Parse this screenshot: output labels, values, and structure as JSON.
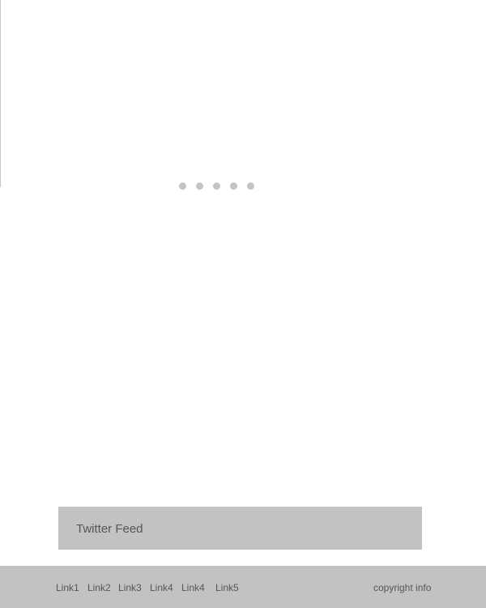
{
  "slider": {
    "dot_count": 5
  },
  "twitter": {
    "label": "Twitter Feed"
  },
  "footer": {
    "links": [
      "Link1",
      "Link2",
      "Link3",
      "Link4",
      "Link4",
      "Link5"
    ],
    "copyright": "copyright info"
  },
  "colors": {
    "panel": "#c2c2c2",
    "dot": "#c4c4c4",
    "text": "#555555"
  }
}
